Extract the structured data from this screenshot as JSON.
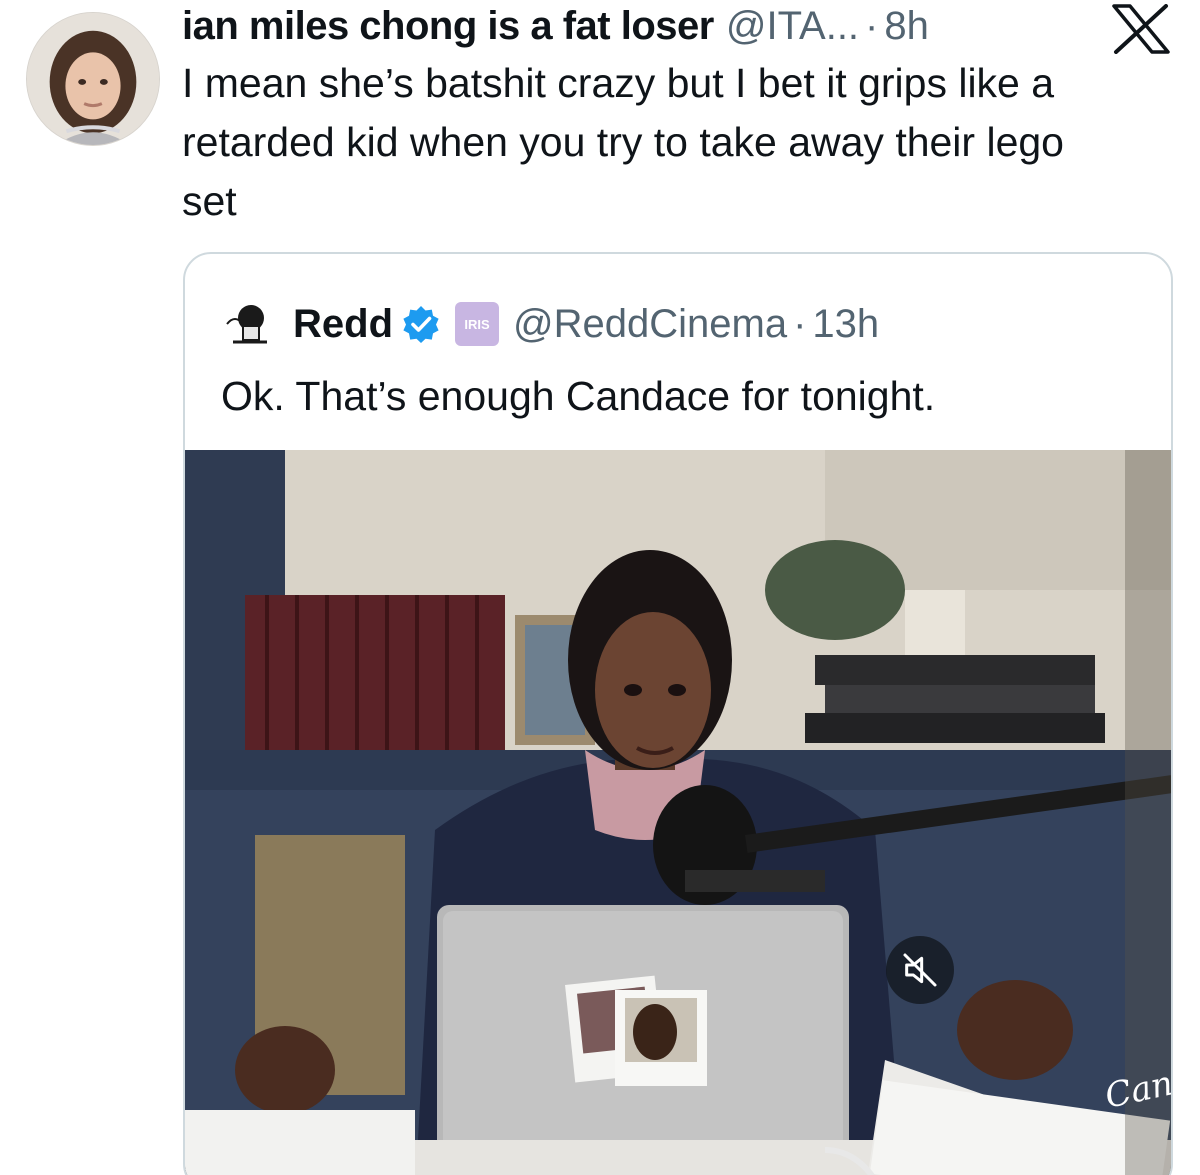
{
  "tweet": {
    "display_name": "ian miles chong is a fat loser",
    "handle": "@ITA...",
    "separator": "·",
    "time": "8h",
    "text": "I mean she’s batshit crazy but I bet it grips like a\nretarded kid when you try to take away their lego\nset"
  },
  "quoted": {
    "display_name": "Redd",
    "affiliate_badge": "IRIS",
    "handle": "@ReddCinema",
    "separator": "·",
    "time": "13h",
    "text": "Ok. That’s enough Candace for tonight.",
    "media_type": "video",
    "video_watermark": "Can"
  },
  "icons": {
    "platform_logo": "x-logo-icon",
    "verified": "verified-badge-icon",
    "mute": "mute-icon"
  },
  "colors": {
    "text_primary": "#0f1419",
    "text_secondary": "#536471",
    "border": "#cfd9de",
    "verified_blue": "#1d9bf0",
    "affiliate_badge": "#c8b6e2"
  }
}
